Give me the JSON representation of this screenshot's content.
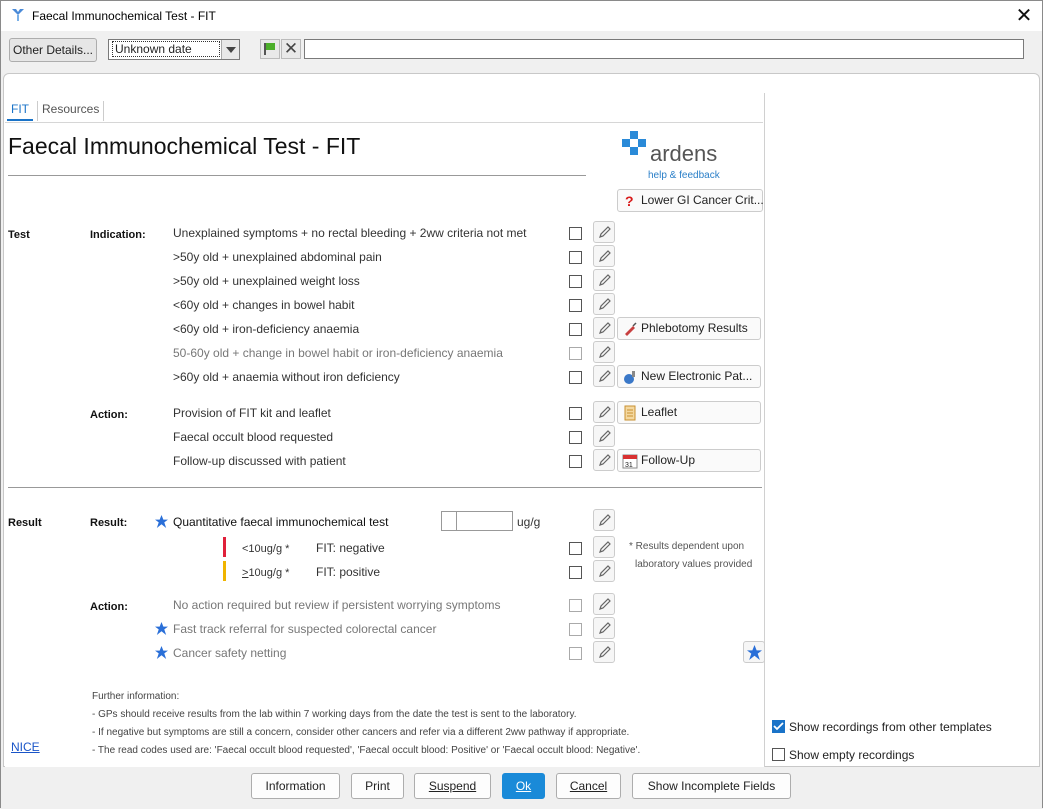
{
  "window": {
    "title": "Faecal Immunochemical Test - FIT",
    "close": "✕"
  },
  "toolbar": {
    "other_details": "Other Details...",
    "date_value": "Unknown date",
    "free_text_value": ""
  },
  "tabs": [
    {
      "label": "FIT"
    },
    {
      "label": "Resources"
    }
  ],
  "form": {
    "title": "Faecal Immunochemical Test - FIT"
  },
  "logo": {
    "name": "ardens",
    "sub": "help & feedback"
  },
  "criteria_button": "Lower GI Cancer Crit...",
  "test": {
    "section": "Test",
    "indication_label": "Indication:",
    "indications": [
      {
        "text": "Unexplained symptoms + no rectal bleeding + 2ww criteria not met",
        "grey": false
      },
      {
        "text": ">50y old + unexplained abdominal pain",
        "grey": false
      },
      {
        "text": ">50y old + unexplained weight loss",
        "grey": false
      },
      {
        "text": "<60y old + changes in bowel habit",
        "grey": false
      },
      {
        "text": "<60y old + iron-deficiency anaemia",
        "grey": false
      },
      {
        "text": "50-60y old + change in bowel habit or iron-deficiency anaemia",
        "grey": true
      },
      {
        "text": ">60y old + anaemia without iron deficiency",
        "grey": false
      }
    ],
    "phlebotomy": "Phlebotomy Results",
    "electronic": "New Electronic Pat...",
    "action_label": "Action:",
    "actions": [
      {
        "text": "Provision of FIT kit and leaflet"
      },
      {
        "text": "Faecal occult blood requested"
      },
      {
        "text": "Follow-up discussed with patient"
      }
    ],
    "leaflet": "Leaflet",
    "followup": "Follow-Up"
  },
  "result": {
    "section": "Result",
    "result_label": "Result:",
    "quant": "Quantitative faecal immunochemical test",
    "quant_value": "",
    "unit": "ug/g",
    "neg_range": "<10ug/g *",
    "neg_text": "FIT: negative",
    "pos_range_prefix": ">",
    "pos_range_rest": "10ug/g *",
    "pos_text": "FIT: positive",
    "note_1": "* Results dependent upon",
    "note_2": "laboratory values provided",
    "action_label": "Action:",
    "actions": [
      {
        "text": "No action required but review if persistent worrying symptoms"
      },
      {
        "text": "Fast track referral for suspected colorectal cancer"
      },
      {
        "text": "Cancer safety netting"
      }
    ]
  },
  "further": {
    "heading": "Further information:",
    "line_1": "- GPs should receive results from the lab within 7 working days from the date the test is sent to the laboratory.",
    "line_2": "- If negative but symptoms are still a concern, consider other cancers and refer via a different 2ww pathway if appropriate.",
    "line_3": "- The read codes used are: 'Faecal occult blood requested', 'Faecal occult blood: Positive' or 'Faecal occult blood: Negative'."
  },
  "nice": "NICE",
  "options": {
    "show_other": "Show recordings from other templates",
    "show_other_checked": true,
    "show_empty": "Show empty recordings",
    "show_empty_checked": false
  },
  "buttons": {
    "information": "Information",
    "print": "Print",
    "suspend": "Suspend",
    "ok": "Ok",
    "cancel": "Cancel",
    "incomplete": "Show Incomplete Fields"
  },
  "colors": {
    "accent": "#1a73c8",
    "negative_bar": "#e0203a",
    "positive_bar": "#f0b400",
    "star": "#2a6fd8"
  }
}
